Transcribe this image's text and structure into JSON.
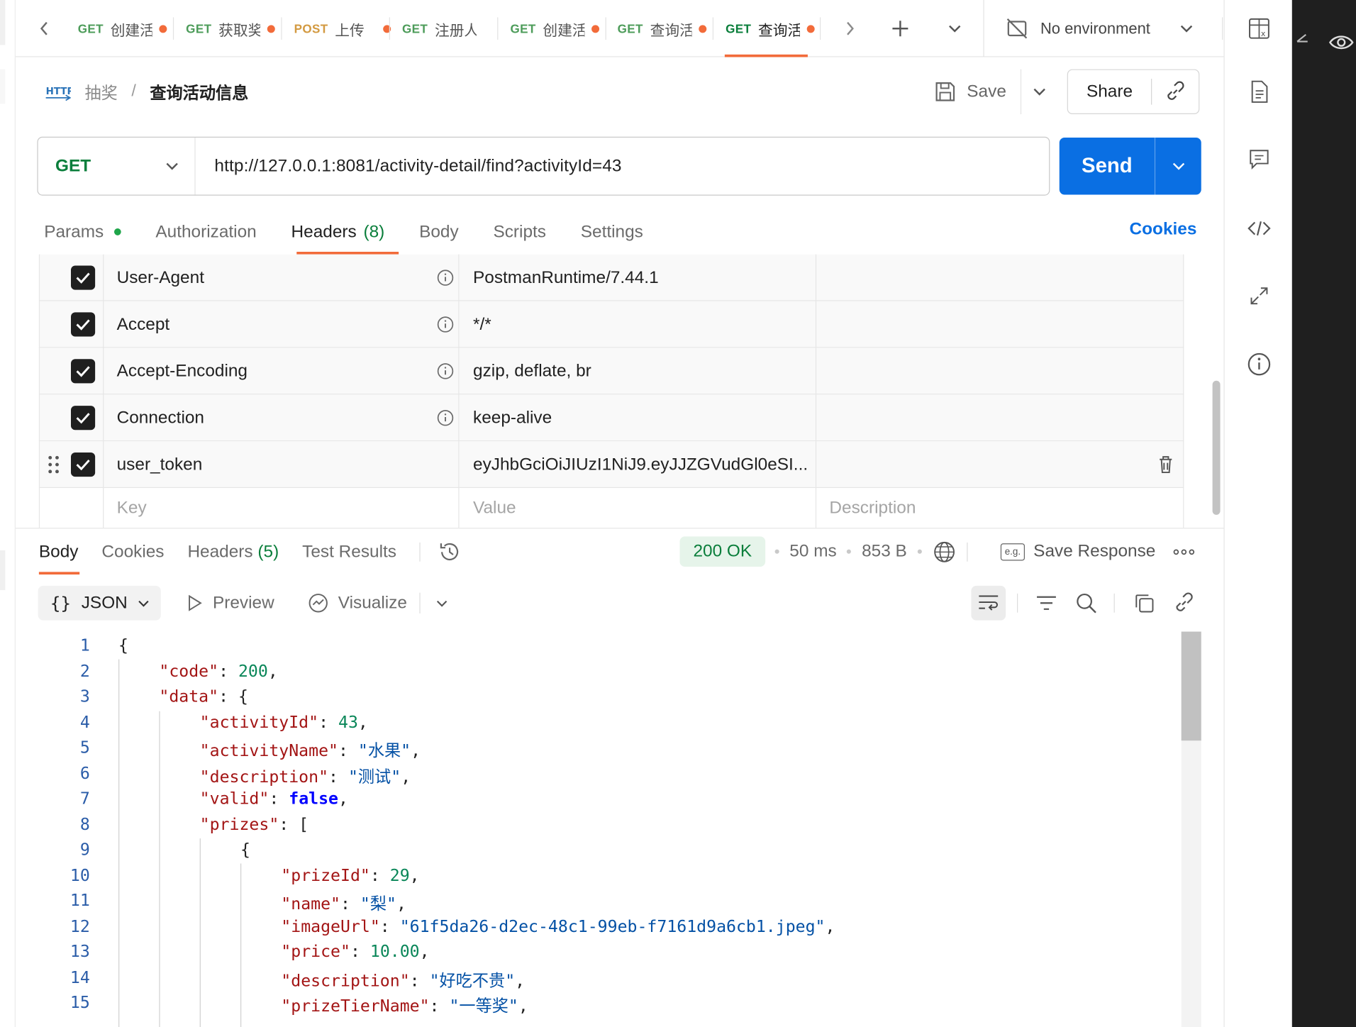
{
  "tabs": {
    "items": [
      {
        "method": "GET",
        "name": "创建活动"
      },
      {
        "method": "GET",
        "name": "获取奖品"
      },
      {
        "method": "POST",
        "name": "上传"
      },
      {
        "method": "GET",
        "name": "注册人员"
      },
      {
        "method": "GET",
        "name": "创建活动"
      },
      {
        "method": "GET",
        "name": "查询活动"
      },
      {
        "method": "GET",
        "name": "查询活动"
      }
    ],
    "environment": "No environment"
  },
  "breadcrumb": {
    "collection": "抽奖",
    "separator": "/",
    "request": "查询活动信息"
  },
  "toolbar": {
    "save_label": "Save",
    "share_label": "Share"
  },
  "request": {
    "method": "GET",
    "url": "http://127.0.0.1:8081/activity-detail/find?activityId=43",
    "send_label": "Send"
  },
  "request_tabs": {
    "params": "Params",
    "authorization": "Authorization",
    "headers": "Headers",
    "headers_count": "(8)",
    "body": "Body",
    "scripts": "Scripts",
    "settings": "Settings",
    "cookies": "Cookies"
  },
  "headers_table": {
    "rows": [
      {
        "key": "User-Agent",
        "value": "PostmanRuntime/7.44.1"
      },
      {
        "key": "Accept",
        "value": "*/*"
      },
      {
        "key": "Accept-Encoding",
        "value": "gzip, deflate, br"
      },
      {
        "key": "Connection",
        "value": "keep-alive"
      },
      {
        "key": "user_token",
        "value": "eyJhbGciOiJIUzI1NiJ9.eyJJZGVudGl0eSI..."
      }
    ],
    "placeholders": {
      "key": "Key",
      "value": "Value",
      "description": "Description"
    }
  },
  "response_tabs": {
    "body": "Body",
    "cookies": "Cookies",
    "headers": "Headers",
    "headers_count": "(5)",
    "test_results": "Test Results"
  },
  "response_meta": {
    "status": "200 OK",
    "time": "50 ms",
    "size": "853 B",
    "save_response": "Save Response",
    "save_response_badge": "e.g."
  },
  "response_view": {
    "format": "JSON",
    "preview": "Preview",
    "visualize": "Visualize"
  },
  "code_lines": [
    {
      "n": "1",
      "t": "{"
    },
    {
      "n": "2",
      "t": "\"code\": 200,"
    },
    {
      "n": "3",
      "t": "\"data\": {"
    },
    {
      "n": "4",
      "t": "\"activityId\": 43,"
    },
    {
      "n": "5",
      "t": "\"activityName\": \"水果\","
    },
    {
      "n": "6",
      "t": "\"description\": \"测试\","
    },
    {
      "n": "7",
      "t": "\"valid\": false,"
    },
    {
      "n": "8",
      "t": "\"prizes\": ["
    },
    {
      "n": "9",
      "t": "{"
    },
    {
      "n": "10",
      "t": "\"prizeId\": 29,"
    },
    {
      "n": "11",
      "t": "\"name\": \"梨\","
    },
    {
      "n": "12",
      "t": "\"imageUrl\": \"61f5da26-d2ec-48c1-99eb-f7161d9a6cb1.jpeg\","
    },
    {
      "n": "13",
      "t": "\"price\": 10.00,"
    },
    {
      "n": "14",
      "t": "\"description\": \"好吃不贵\","
    },
    {
      "n": "15",
      "t": "\"prizeTierName\": \"一等奖\","
    }
  ]
}
